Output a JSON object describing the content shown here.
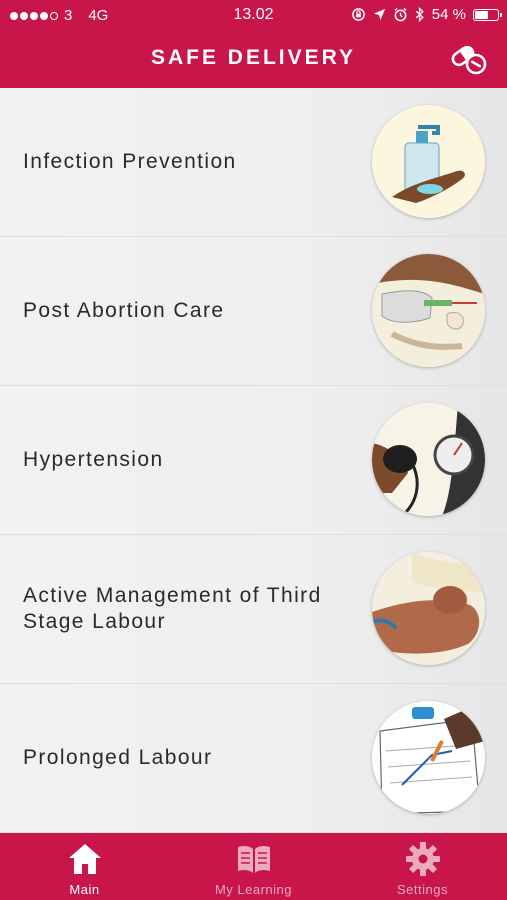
{
  "status_bar": {
    "carrier": "3",
    "network": "4G",
    "time": "13.02",
    "battery_percent": "54 %",
    "battery_level": 0.54,
    "signal_bars_filled": 4,
    "signal_bars_total": 5
  },
  "header": {
    "title": "SAFE DELIVERY",
    "action_icon": "pills-icon"
  },
  "list": {
    "items": [
      {
        "label": "Infection Prevention",
        "icon": "hand-sanitizer-image"
      },
      {
        "label": "Post Abortion Care",
        "icon": "post-abortion-care-image"
      },
      {
        "label": "Hypertension",
        "icon": "blood-pressure-image"
      },
      {
        "label": "Active Management of Third Stage Labour",
        "icon": "newborn-image"
      },
      {
        "label": "Prolonged Labour",
        "icon": "partograph-image"
      }
    ]
  },
  "tab_bar": {
    "tabs": [
      {
        "label": "Main",
        "icon": "home-icon",
        "active": true
      },
      {
        "label": "My Learning",
        "icon": "book-icon",
        "active": false
      },
      {
        "label": "Settings",
        "icon": "gear-icon",
        "active": false
      }
    ]
  },
  "colors": {
    "brand": "#c8164a",
    "tab_inactive": "#ecaabd",
    "background": "#efefef"
  }
}
